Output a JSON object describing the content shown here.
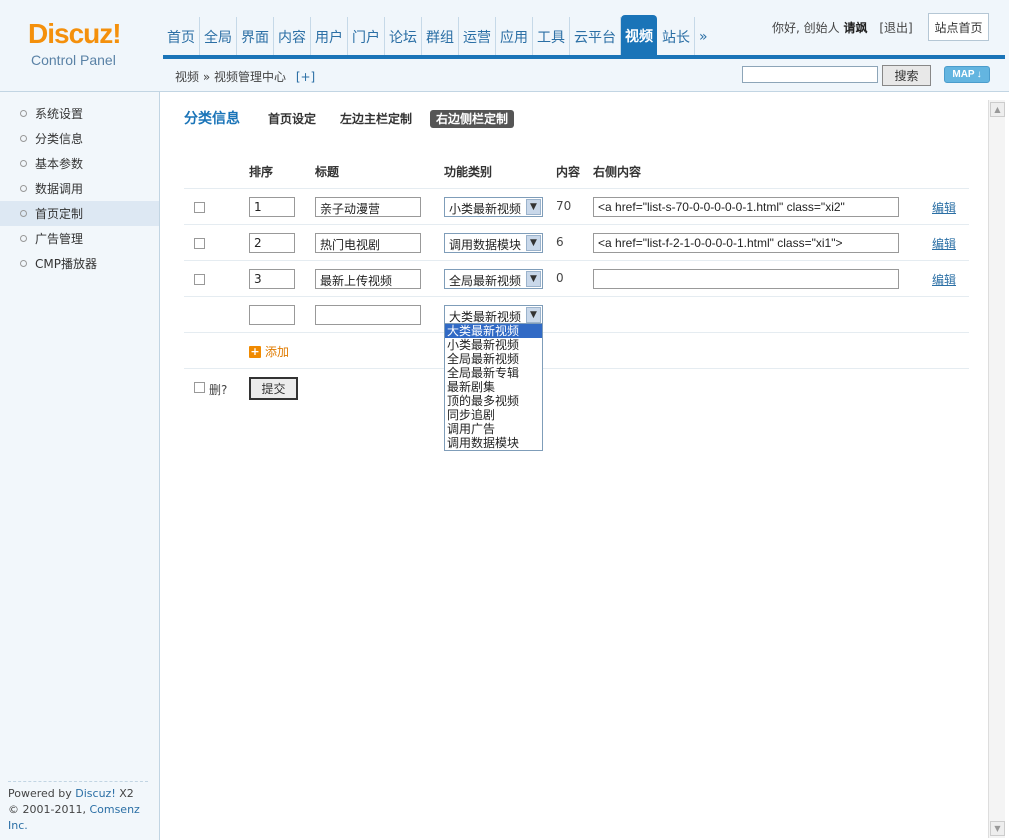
{
  "logo": {
    "brand": "Discuz!",
    "sub": "Control Panel"
  },
  "nav": {
    "items": [
      "首页",
      "全局",
      "界面",
      "内容",
      "用户",
      "门户",
      "论坛",
      "群组",
      "运营",
      "应用",
      "工具",
      "云平台",
      "视频",
      "站长",
      "»"
    ],
    "active": "视频"
  },
  "user": {
    "greeting": "你好, 创始人",
    "name": "请飒",
    "logout": "[退出]",
    "site_home": "站点首页"
  },
  "breadcrumb": {
    "text": "视频 » 视频管理中心",
    "plus": "[+]"
  },
  "search": {
    "value": "",
    "button": "搜索",
    "map": "MAP"
  },
  "sidebar": {
    "items": [
      {
        "label": "系统设置"
      },
      {
        "label": "分类信息"
      },
      {
        "label": "基本参数"
      },
      {
        "label": "数据调用"
      },
      {
        "label": "首页定制"
      },
      {
        "label": "广告管理"
      },
      {
        "label": "CMP播放器"
      }
    ],
    "active": "首页定制",
    "footer_prefix": "Powered by",
    "footer_brand": "Discuz!",
    "footer_ver": "X2",
    "footer_copy": "© 2001-2011,",
    "footer_company": "Comsenz Inc."
  },
  "main": {
    "title": "分类信息",
    "tabs": [
      "首页设定",
      "左边主栏定制",
      "右边侧栏定制"
    ],
    "active_tab": "右边侧栏定制",
    "headers": {
      "order": "排序",
      "title": "标题",
      "type": "功能类别",
      "content": "内容",
      "right": "右侧内容"
    },
    "rows": [
      {
        "order": "1",
        "title": "亲子动漫营",
        "type": "小类最新视频",
        "content": "70",
        "right": "<a href=\"list-s-70-0-0-0-0-0-1.html\" class=\"xi2\"",
        "edit": "编辑"
      },
      {
        "order": "2",
        "title": "热门电视剧",
        "type": "调用数据模块",
        "content": "6",
        "right": "<a href=\"list-f-2-1-0-0-0-0-1.html\" class=\"xi1\">",
        "edit": "编辑"
      },
      {
        "order": "3",
        "title": "最新上传视频",
        "type": "全局最新视频",
        "content": "0",
        "right": "",
        "edit": "编辑"
      }
    ],
    "new_row": {
      "order": "",
      "title": "",
      "type": "大类最新视频"
    },
    "add_label": "添加",
    "delete_label": "删?",
    "submit_label": "提交",
    "dropdown_options": [
      "大类最新视频",
      "小类最新视频",
      "全局最新视频",
      "全局最新专辑",
      "最新剧集",
      "顶的最多视频",
      "同步追剧",
      "调用广告",
      "调用数据模块"
    ],
    "dropdown_highlight": "大类最新视频"
  },
  "colors": {
    "brand": "#f4900c",
    "accent": "#1a74b8",
    "link": "#2b6fa5",
    "highlight": "#316ac5",
    "add": "#f08a00"
  }
}
